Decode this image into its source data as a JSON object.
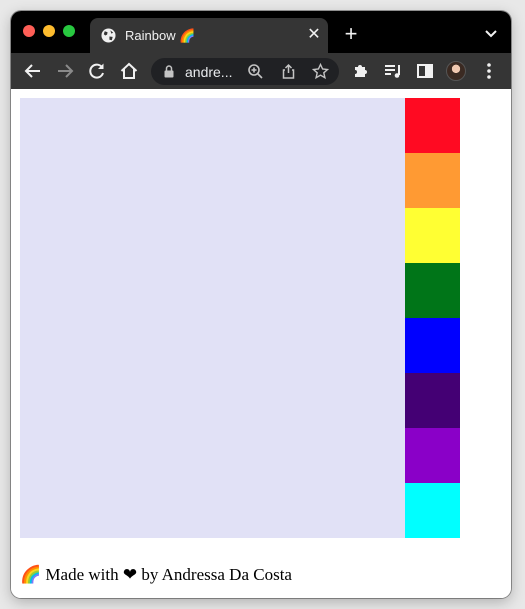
{
  "browser": {
    "tab": {
      "title": "Rainbow 🌈"
    },
    "address_bar": {
      "url": "andre..."
    }
  },
  "palette": {
    "colors": [
      {
        "name": "red",
        "hex": "#ff0a22"
      },
      {
        "name": "orange",
        "hex": "#ff9a33"
      },
      {
        "name": "yellow",
        "hex": "#ffff33"
      },
      {
        "name": "green",
        "hex": "#007518"
      },
      {
        "name": "blue",
        "hex": "#0000ff"
      },
      {
        "name": "indigo",
        "hex": "#440074"
      },
      {
        "name": "violet",
        "hex": "#8a00c8"
      },
      {
        "name": "cyan",
        "hex": "#00ffff"
      }
    ]
  },
  "canvas": {
    "color": "#e1e1f6"
  },
  "footer": {
    "text": "🌈 Made with ❤ by Andressa Da Costa"
  }
}
